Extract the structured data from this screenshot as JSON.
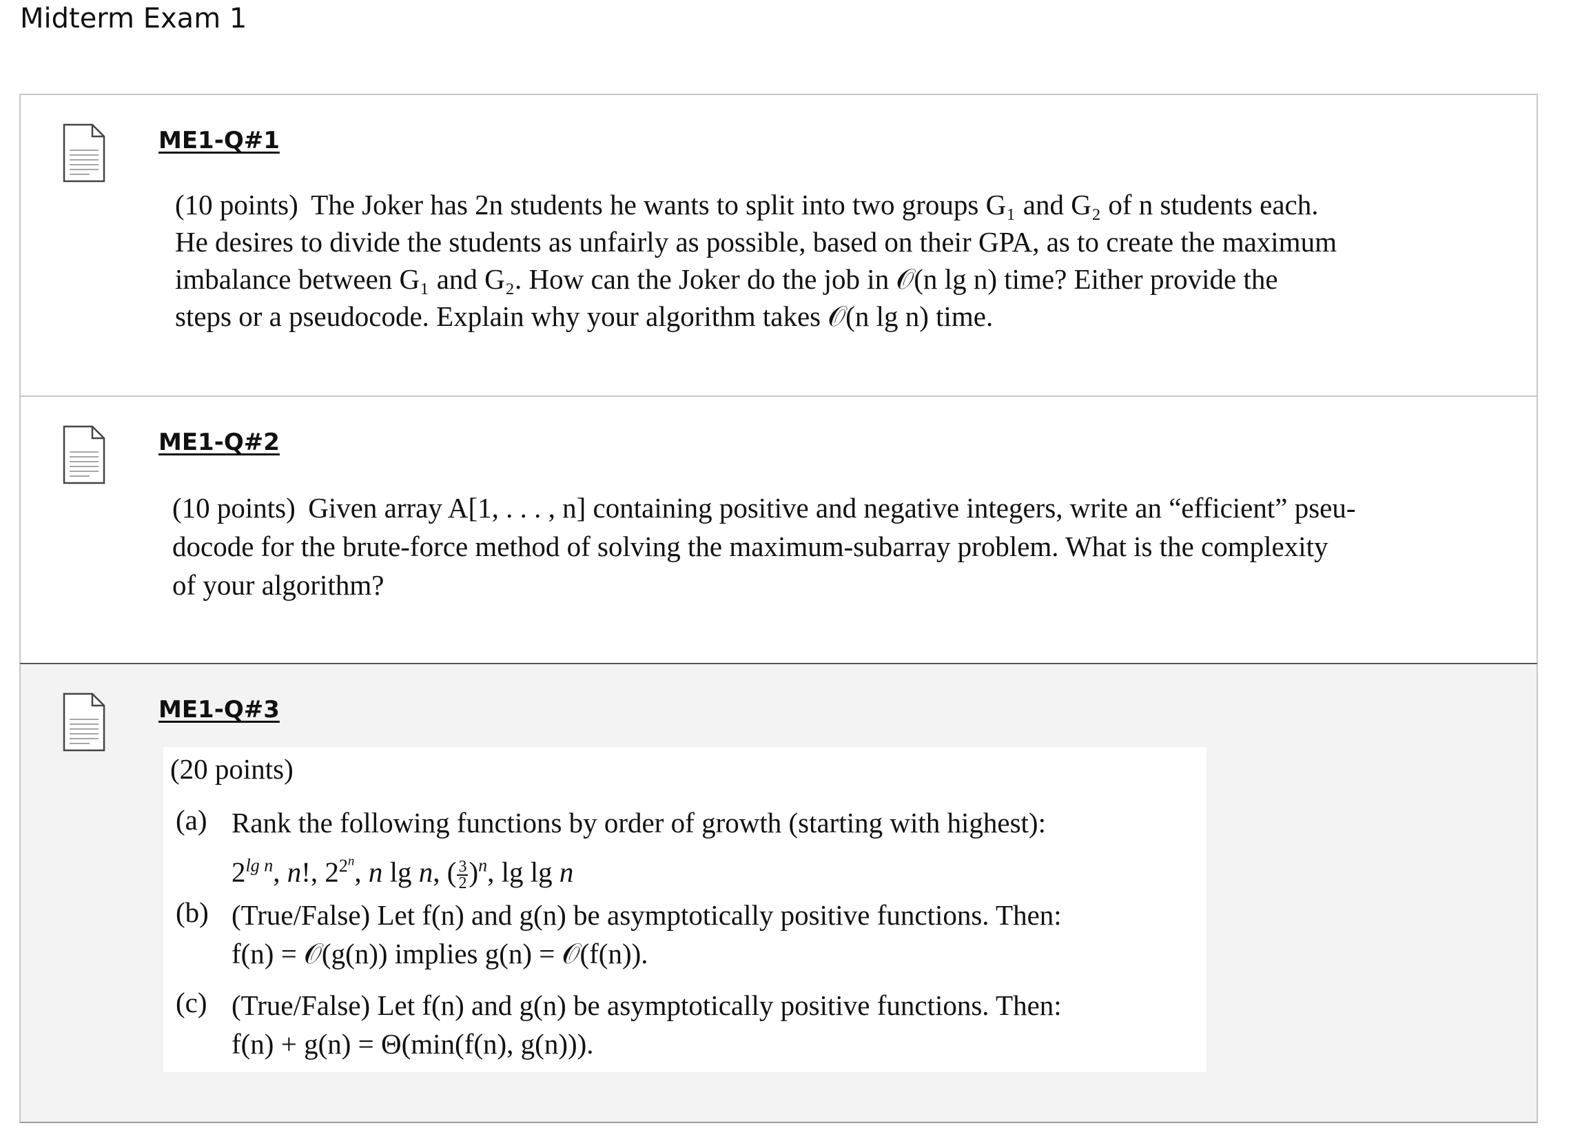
{
  "page": {
    "title": "Midterm Exam 1"
  },
  "icons": {
    "question": "document-icon"
  },
  "questions": [
    {
      "link": "ME1-Q#1",
      "points": "(10 points)",
      "line1": "The Joker has 2n students he wants to split into two groups G₁ and G₂ of n students each.",
      "line2": "He desires to divide the students as unfairly as possible, based on their GPA, as to create the maximum",
      "line3": "imbalance between G₁ and G₂. How can the Joker do the job in 𝒪(n lg n) time? Either provide the",
      "line4": "steps or a pseudocode. Explain why your algorithm takes 𝒪(n lg n) time."
    },
    {
      "link": "ME1-Q#2",
      "points": "(10 points)",
      "line1": "Given array A[1, . . . , n] containing positive and negative integers, write an “efficient” pseu-",
      "line2": "docode for the brute-force method of solving the maximum-subarray problem. What is the complexity",
      "line3": "of your algorithm?"
    },
    {
      "link": "ME1-Q#3",
      "points": "(20 points)",
      "a_label": "(a)",
      "a_line1": "Rank the following functions by order of growth (starting with highest):",
      "a_line2": "2^(lg n), n!, 2^(2^n), n lg n, (3/2)^n, lg lg n",
      "b_label": "(b)",
      "b_line1": "(True/False) Let f(n) and g(n) be asymptotically positive functions. Then:",
      "b_line2": "f(n) = 𝒪(g(n)) implies g(n) = 𝒪(f(n)).",
      "c_label": "(c)",
      "c_line1": "(True/False) Let f(n) and g(n) be asymptotically positive functions. Then:",
      "c_line2": "f(n) + g(n) = Θ(min(f(n), g(n)))."
    }
  ]
}
